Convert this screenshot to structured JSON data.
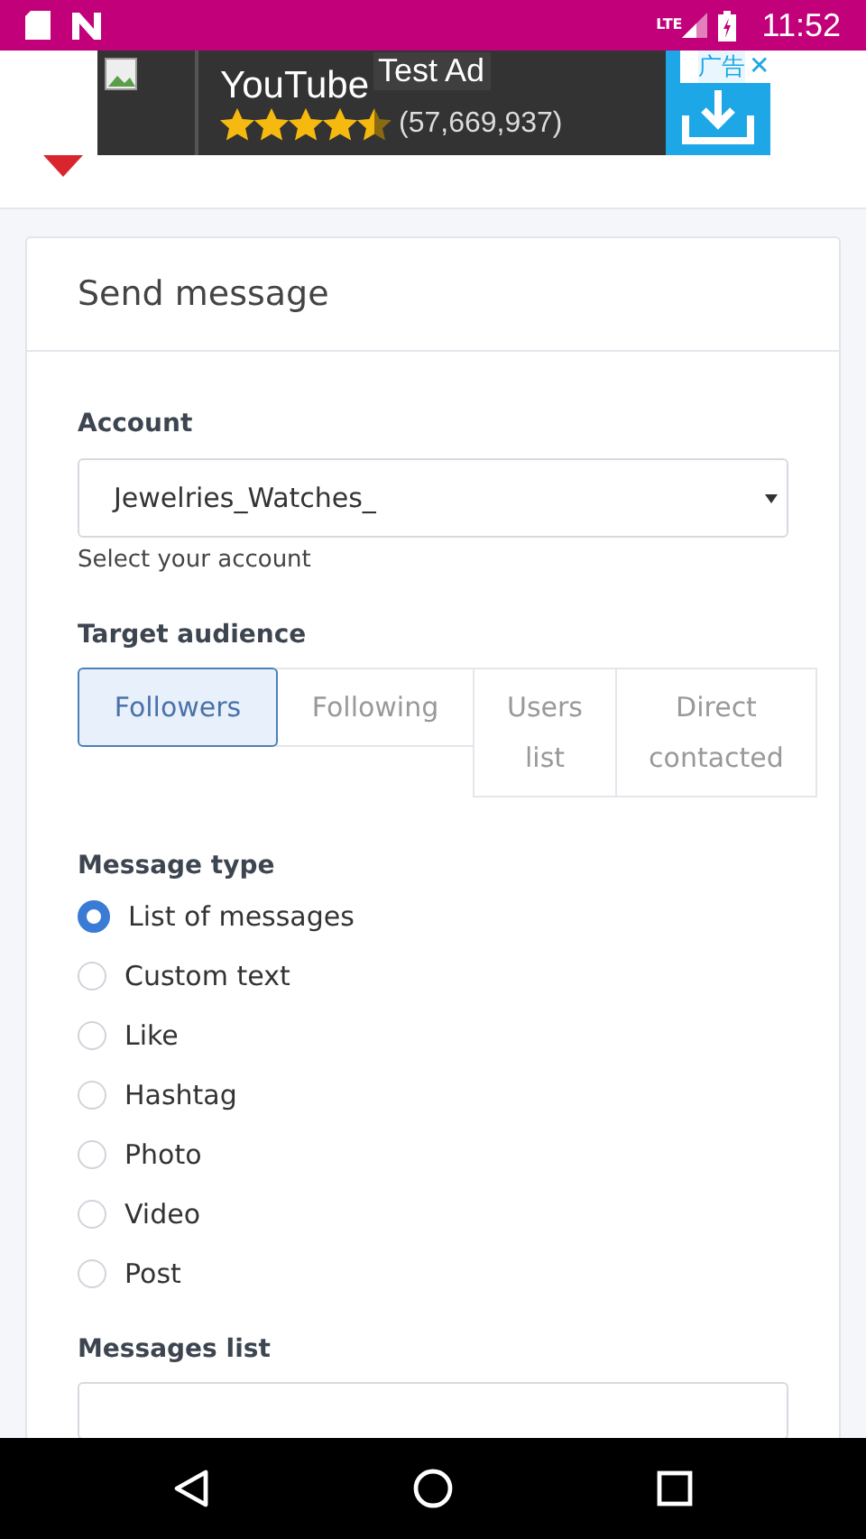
{
  "status_bar": {
    "time": "11:52",
    "network": "LTE"
  },
  "ad": {
    "title": "YouTube",
    "badge": "Test Ad",
    "stars": 4.5,
    "count": "(57,669,937)",
    "label": "广告",
    "close": "✕"
  },
  "card": {
    "title": "Send message",
    "account": {
      "label": "Account",
      "value": "Jewelries_Watches_",
      "help": "Select your account"
    },
    "audience": {
      "label": "Target audience",
      "options": [
        {
          "label": "Followers",
          "selected": true
        },
        {
          "label": "Following",
          "selected": false
        },
        {
          "label": "Users list",
          "selected": false
        },
        {
          "label": "Direct contacted",
          "selected": false
        }
      ]
    },
    "message_type": {
      "label": "Message type",
      "options": [
        {
          "label": "List of messages",
          "selected": true
        },
        {
          "label": "Custom text",
          "selected": false
        },
        {
          "label": "Like",
          "selected": false
        },
        {
          "label": "Hashtag",
          "selected": false
        },
        {
          "label": "Photo",
          "selected": false
        },
        {
          "label": "Video",
          "selected": false
        },
        {
          "label": "Post",
          "selected": false
        }
      ]
    },
    "messages_list": {
      "label": "Messages list"
    }
  }
}
